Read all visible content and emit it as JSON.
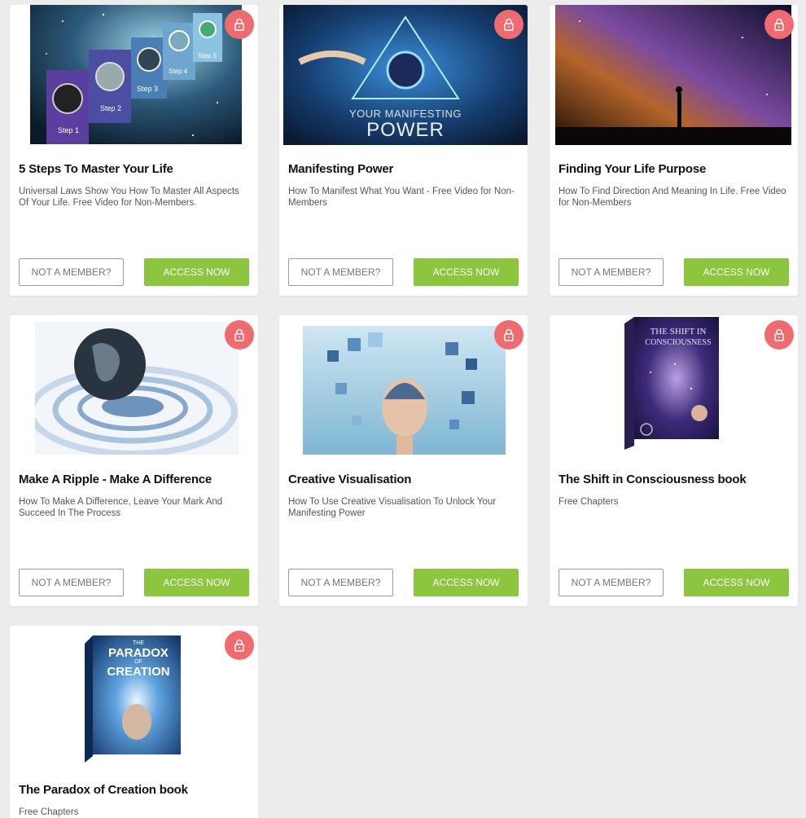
{
  "colors": {
    "accent_green": "#8cc63f",
    "lock_red": "#ef6b6f",
    "background": "#ececec"
  },
  "cards": [
    {
      "title": "5 Steps To Master Your Life",
      "description": "Universal Laws Show You How To Master All Aspects Of Your Life. Free Video for Non-Members.",
      "image_labels": [
        "Step 1",
        "Step 2",
        "Step 3",
        "Step 4",
        "Step 5"
      ],
      "not_member_label": "NOT A MEMBER?",
      "access_label": "ACCESS NOW"
    },
    {
      "title": "Manifesting Power",
      "description": "How To Manifest What You Want - Free Video for Non-Members",
      "image_caption_line1": "YOUR MANIFESTING",
      "image_caption_line2": "POWER",
      "not_member_label": "NOT A MEMBER?",
      "access_label": "ACCESS NOW"
    },
    {
      "title": "Finding Your Life Purpose",
      "description": "How To Find Direction And Meaning In Life. Free Video for Non-Members",
      "not_member_label": "NOT A MEMBER?",
      "access_label": "ACCESS NOW"
    },
    {
      "title": "Make A Ripple - Make A Difference",
      "description": "How To Make A Difference, Leave Your Mark And Succeed In The Process",
      "not_member_label": "NOT A MEMBER?",
      "access_label": "ACCESS NOW"
    },
    {
      "title": "Creative Visualisation",
      "description": "How To Use Creative Visualisation To Unlock Your Manifesting Power",
      "not_member_label": "NOT A MEMBER?",
      "access_label": "ACCESS NOW"
    },
    {
      "title": "The Shift in Consciousness book",
      "description": "Free Chapters",
      "image_caption_line1": "THE SHIFT IN",
      "image_caption_line2": "CONSCIOUSNESS",
      "not_member_label": "NOT A MEMBER?",
      "access_label": "ACCESS NOW"
    },
    {
      "title": "The Paradox of Creation book",
      "description": "Free Chapters",
      "image_caption_line1": "THE",
      "image_caption_line2": "PARADOX",
      "image_caption_line3": "OF",
      "image_caption_line4": "CREATION"
    }
  ],
  "icons": {
    "lock": "lock-icon"
  }
}
